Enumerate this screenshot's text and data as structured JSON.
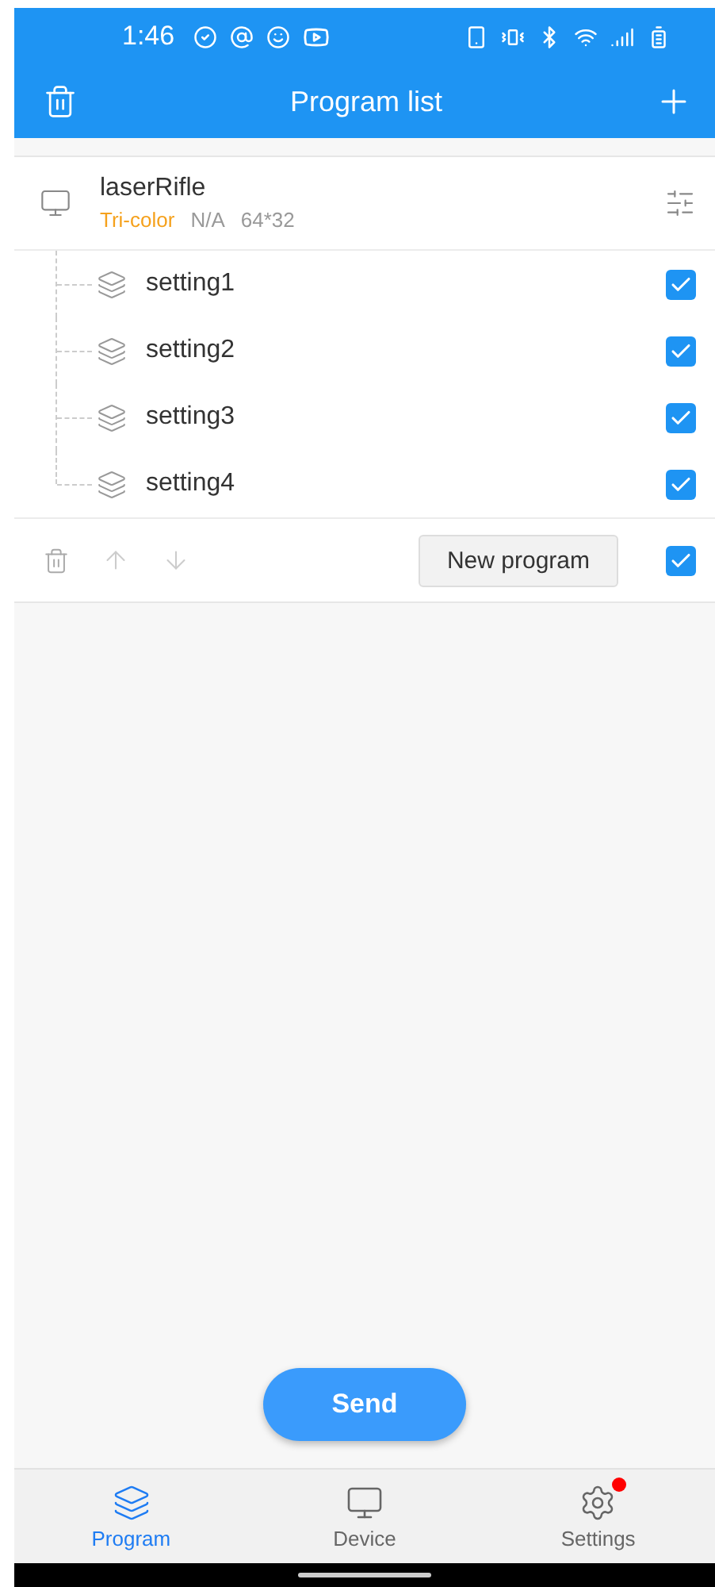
{
  "status_bar": {
    "time": "1:46"
  },
  "header": {
    "title": "Program list"
  },
  "program": {
    "name": "laserRifle",
    "color_mode": "Tri-color",
    "status": "N/A",
    "size": "64*32",
    "settings": [
      {
        "name": "setting1",
        "checked": true
      },
      {
        "name": "setting2",
        "checked": true
      },
      {
        "name": "setting3",
        "checked": true
      },
      {
        "name": "setting4",
        "checked": true
      }
    ]
  },
  "toolbar": {
    "new_button": "New program",
    "checked": true
  },
  "send_button": "Send",
  "bottom_nav": [
    {
      "label": "Program",
      "selected": true,
      "badge": false
    },
    {
      "label": "Device",
      "selected": false,
      "badge": false
    },
    {
      "label": "Settings",
      "selected": false,
      "badge": true
    }
  ]
}
